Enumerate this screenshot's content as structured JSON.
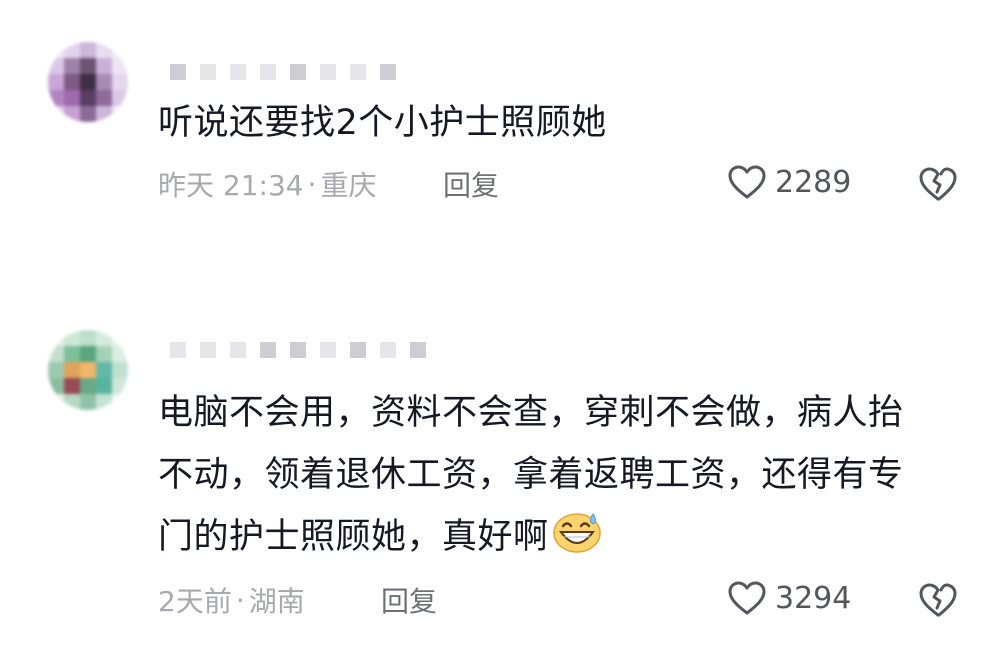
{
  "comments": [
    {
      "text": "听说还要找2个小护士照顾她",
      "time": "昨天 21:34",
      "separator": "·",
      "location": "重庆",
      "reply_label": "回复",
      "like_count": "2289",
      "icons": {
        "like": "heart-outline-icon",
        "dislike": "broken-heart-icon"
      }
    },
    {
      "text_lines": [
        "电脑不会用，资料不会查，穿刺不会做，病人抬",
        "不动，领着退休工资，拿着返聘工资，还得有专",
        "门的护士照顾她，真好啊"
      ],
      "emoji": "grinning-sweat-emoji",
      "time": "2天前",
      "separator": "·",
      "location": "湖南",
      "reply_label": "回复",
      "like_count": "3294",
      "icons": {
        "like": "heart-outline-icon",
        "dislike": "broken-heart-icon"
      }
    }
  ],
  "colors": {
    "text_primary": "#161823",
    "text_secondary": "#a8a9ae",
    "reply": "#6f7076",
    "icon": "#55565c"
  }
}
